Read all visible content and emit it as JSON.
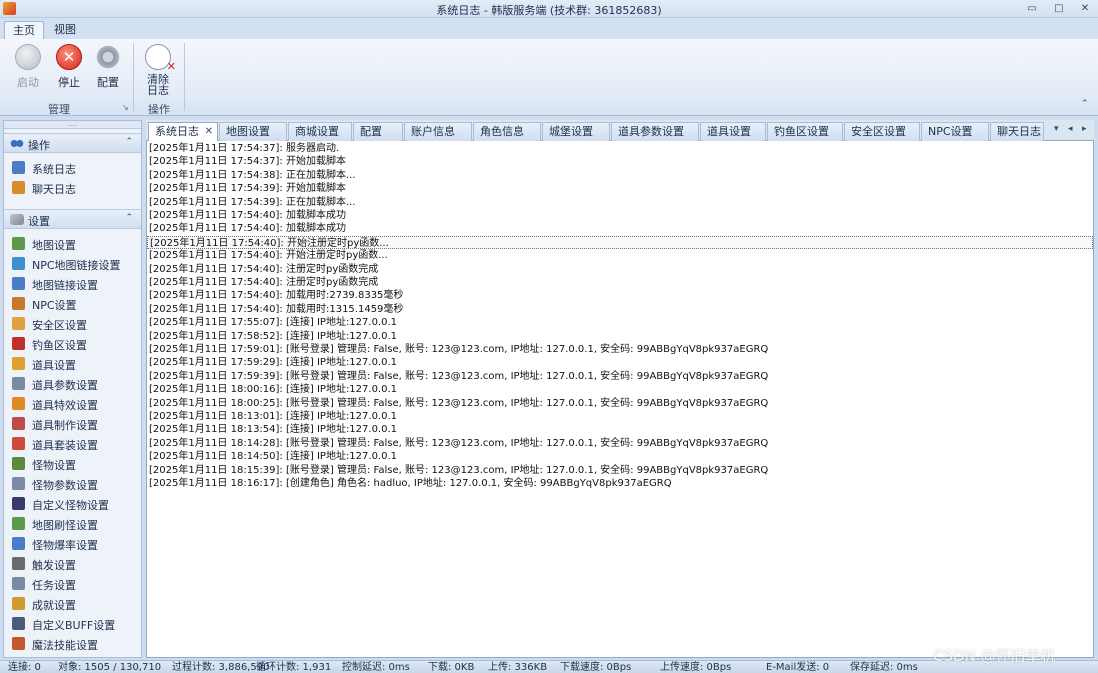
{
  "window": {
    "title": "系统日志 - 韩版服务端 (技术群: 361852683)",
    "min_symbol": "▭",
    "max_symbol": "□",
    "close_symbol": "✕"
  },
  "ribbon_tabs": [
    "主页",
    "视图"
  ],
  "ribbon": {
    "start_label": "启动",
    "stop_label": "停止",
    "stop_symbol": "✕",
    "config_label": "配置",
    "clear_log_label": "清除\n日志",
    "group_manage": "管理",
    "group_ops": "操作",
    "launcher_symbol": "↘",
    "collapse_symbol": "⌃"
  },
  "nav": {
    "grip": "....",
    "groups": [
      {
        "label": "操作",
        "icon": "ops-icon",
        "chevron": "⌃",
        "items": [
          {
            "label": "系统日志",
            "icon": "system-log-icon",
            "color": "#4a7cc8"
          },
          {
            "label": "聊天日志",
            "icon": "chat-log-icon",
            "color": "#d98a2a"
          }
        ]
      },
      {
        "label": "设置",
        "icon": "settings-icon",
        "chevron": "⌃",
        "items": [
          {
            "label": "地图设置",
            "icon": "map-icon",
            "color": "#5c9a4a"
          },
          {
            "label": "NPC地图链接设置",
            "icon": "npc-link-icon",
            "color": "#3d8fd1"
          },
          {
            "label": "地图链接设置",
            "icon": "map-link-icon",
            "color": "#4a7cc8"
          },
          {
            "label": "NPC设置",
            "icon": "npc-icon",
            "color": "#c8782a"
          },
          {
            "label": "安全区设置",
            "icon": "safe-zone-icon",
            "color": "#e0a040"
          },
          {
            "label": "钓鱼区设置",
            "icon": "fishing-icon",
            "color": "#c0302a"
          },
          {
            "label": "道具设置",
            "icon": "item-icon",
            "color": "#e0a030"
          },
          {
            "label": "道具参数设置",
            "icon": "item-params-icon",
            "color": "#7a8aa4"
          },
          {
            "label": "道具特效设置",
            "icon": "item-effect-icon",
            "color": "#e08a20"
          },
          {
            "label": "道具制作设置",
            "icon": "item-craft-icon",
            "color": "#c04a4a"
          },
          {
            "label": "道具套装设置",
            "icon": "item-set-icon",
            "color": "#d04a3a"
          },
          {
            "label": "怪物设置",
            "icon": "monster-icon",
            "color": "#5a8a3a"
          },
          {
            "label": "怪物参数设置",
            "icon": "monster-params-icon",
            "color": "#7a8aa4"
          },
          {
            "label": "自定义怪物设置",
            "icon": "custom-monster-icon",
            "color": "#3a3a6a"
          },
          {
            "label": "地图刷怪设置",
            "icon": "map-spawn-icon",
            "color": "#5c9a4a"
          },
          {
            "label": "怪物爆率设置",
            "icon": "drop-rate-icon",
            "color": "#4a7cc8"
          },
          {
            "label": "触发设置",
            "icon": "trigger-icon",
            "color": "#6a6a6a"
          },
          {
            "label": "任务设置",
            "icon": "quest-icon",
            "color": "#7a8aa4"
          },
          {
            "label": "成就设置",
            "icon": "achievement-icon",
            "color": "#d09a30"
          },
          {
            "label": "自定义BUFF设置",
            "icon": "buff-icon",
            "color": "#4a5a7a"
          },
          {
            "label": "魔法技能设置",
            "icon": "magic-skill-icon",
            "color": "#c05a2a"
          }
        ]
      }
    ]
  },
  "doc_tabs": [
    "系统日志",
    "地图设置",
    "商城设置",
    "配置",
    "账户信息",
    "角色信息",
    "城堡设置",
    "道具参数设置",
    "道具设置",
    "钓鱼区设置",
    "安全区设置",
    "NPC设置",
    "聊天日志"
  ],
  "doc_tab_close": "✕",
  "tab_nav": {
    "dropdown": "▾",
    "prev": "◂",
    "next": "▸"
  },
  "log_lines": [
    "[2025年1月11日 17:54:37]: 服务器启动.",
    "[2025年1月11日 17:54:37]: 开始加载脚本",
    "[2025年1月11日 17:54:38]: 正在加载脚本...",
    "[2025年1月11日 17:54:39]: 开始加载脚本",
    "[2025年1月11日 17:54:39]: 正在加载脚本...",
    "[2025年1月11日 17:54:40]: 加载脚本成功",
    "[2025年1月11日 17:54:40]: 加载脚本成功",
    "[2025年1月11日 17:54:40]: 开始注册定时py函数...",
    "[2025年1月11日 17:54:40]: 开始注册定时py函数...",
    "[2025年1月11日 17:54:40]: 注册定时py函数完成",
    "[2025年1月11日 17:54:40]: 注册定时py函数完成",
    "[2025年1月11日 17:54:40]: 加载用时:2739.8335毫秒",
    "[2025年1月11日 17:54:40]: 加载用时:1315.1459毫秒",
    "[2025年1月11日 17:55:07]: [连接] IP地址:127.0.0.1",
    "[2025年1月11日 17:58:52]: [连接] IP地址:127.0.0.1",
    "[2025年1月11日 17:59:01]: [账号登录] 管理员: False, 账号: 123@123.com, IP地址: 127.0.0.1, 安全码: 99ABBgYqV8pk937aEGRQ",
    "[2025年1月11日 17:59:29]: [连接] IP地址:127.0.0.1",
    "[2025年1月11日 17:59:39]: [账号登录] 管理员: False, 账号: 123@123.com, IP地址: 127.0.0.1, 安全码: 99ABBgYqV8pk937aEGRQ",
    "[2025年1月11日 18:00:16]: [连接] IP地址:127.0.0.1",
    "[2025年1月11日 18:00:25]: [账号登录] 管理员: False, 账号: 123@123.com, IP地址: 127.0.0.1, 安全码: 99ABBgYqV8pk937aEGRQ",
    "[2025年1月11日 18:13:01]: [连接] IP地址:127.0.0.1",
    "[2025年1月11日 18:13:54]: [连接] IP地址:127.0.0.1",
    "[2025年1月11日 18:14:28]: [账号登录] 管理员: False, 账号: 123@123.com, IP地址: 127.0.0.1, 安全码: 99ABBgYqV8pk937aEGRQ",
    "[2025年1月11日 18:14:50]: [连接] IP地址:127.0.0.1",
    "[2025年1月11日 18:15:39]: [账号登录] 管理员: False, 账号: 123@123.com, IP地址: 127.0.0.1, 安全码: 99ABBgYqV8pk937aEGRQ",
    "[2025年1月11日 18:16:17]: [创建角色] 角色名: hadluo, IP地址: 127.0.0.1, 安全码: 99ABBgYqV8pk937aEGRQ"
  ],
  "selected_log_index": 7,
  "status": [
    "连接: 0",
    "对象: 1505 / 130,710",
    "过程计数: 3,886,590",
    "循环计数: 1,931",
    "控制延迟: 0ms",
    "下载: 0KB",
    "上传: 336KB",
    "下载速度: 0Bps",
    "上传速度: 0Bps",
    "E-Mail发送: 0",
    "保存延迟: 0ms"
  ],
  "watermark": "CSDN @怀旧单机"
}
